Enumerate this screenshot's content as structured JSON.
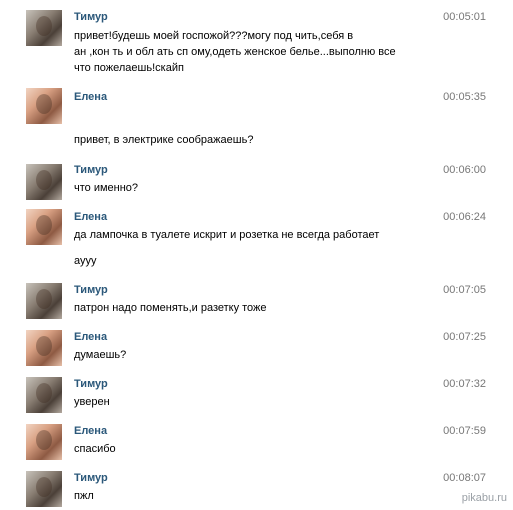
{
  "messages": [
    {
      "author": "Тимур",
      "time": "00:05:01",
      "type": "timur",
      "lines": [
        "привет!будешь моей госпожой???могу под  чить,себя в",
        "ан  ,кон   ть и обл  ать сп  ому,одеть женское белье...выполню все",
        "что пожелаешь!скайп"
      ]
    },
    {
      "author": "Елена",
      "time": "00:05:35",
      "type": "elena",
      "lines": [
        "привет, в электрике соображаешь?"
      ]
    },
    {
      "author": "Тимур",
      "time": "00:06:00",
      "type": "timur",
      "lines": [
        "что именно?"
      ]
    },
    {
      "author": "Елена",
      "time": "00:06:24",
      "type": "elena",
      "lines": [
        "да лампочка в туалете искрит и розетка не всегда работает",
        "аууу"
      ]
    },
    {
      "author": "Тимур",
      "time": "00:07:05",
      "type": "timur",
      "lines": [
        "патрон надо поменять,и разетку тоже"
      ]
    },
    {
      "author": "Елена",
      "time": "00:07:25",
      "type": "elena",
      "lines": [
        "думаешь?"
      ]
    },
    {
      "author": "Тимур",
      "time": "00:07:32",
      "type": "timur",
      "lines": [
        "уверен"
      ]
    },
    {
      "author": "Елена",
      "time": "00:07:59",
      "type": "elena",
      "lines": [
        "спасибо"
      ]
    },
    {
      "author": "Тимур",
      "time": "00:08:07",
      "type": "timur",
      "lines": [
        "пжл"
      ]
    }
  ],
  "watermark": "pikabu.ru"
}
